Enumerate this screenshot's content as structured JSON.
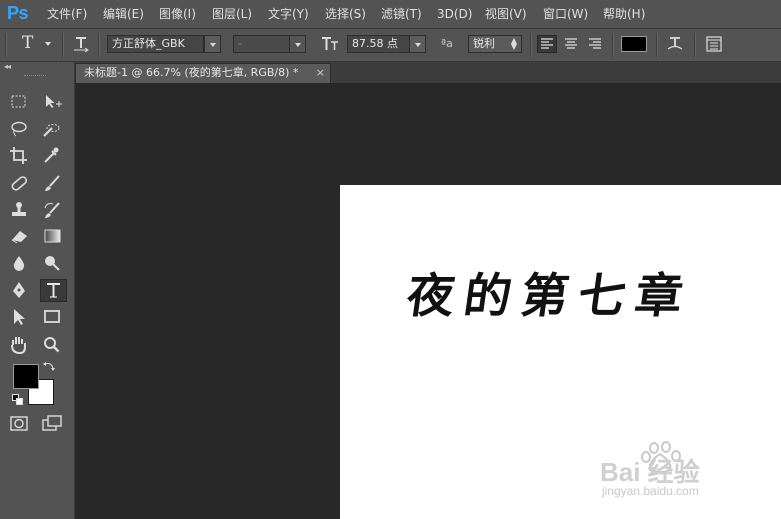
{
  "app": {
    "logo": "Ps"
  },
  "menu": [
    "文件(F)",
    "编辑(E)",
    "图像(I)",
    "图层(L)",
    "文字(Y)",
    "选择(S)",
    "滤镜(T)",
    "3D(D)",
    "视图(V)",
    "窗口(W)",
    "帮助(H)"
  ],
  "options": {
    "tool_glyph": "T",
    "font_family": "方正舒体_GBK",
    "font_style": "-",
    "font_size": "87.58 点",
    "aa_label": "ªa",
    "antialias": "锐利",
    "text_color": "#000000"
  },
  "document": {
    "tab_title": "未标题-1 @ 66.7% (夜的第七章, RGB/8) *",
    "close_glyph": "×",
    "text_content": "夜的第七章"
  },
  "toolbox": {
    "collapse_glyph": "◂◂",
    "foreground_color": "#000000",
    "background_color": "#ffffff"
  },
  "watermark": {
    "brand": "Bai 经验",
    "url": "jingyan.baidu.com"
  }
}
